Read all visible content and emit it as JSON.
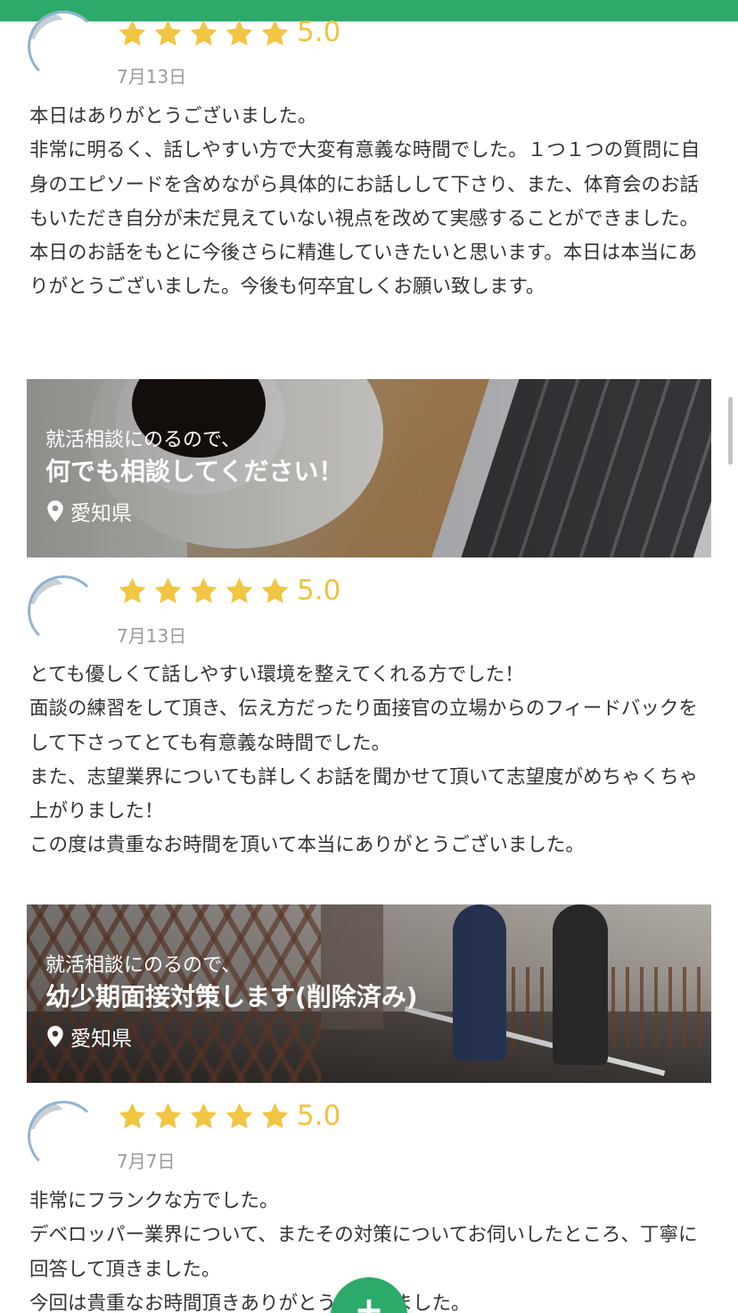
{
  "theme": {
    "accent": "#2baa6a",
    "star": "#f2c542"
  },
  "reviews": [
    {
      "score": "5.0",
      "date": "7月13日",
      "text": "本日はありがとうございました。\n非常に明るく、話しやすい方で大変有意義な時間でした。１つ１つの質問に自身のエピソードを含めながら具体的にお話しして下さり、また、体育会のお話もいただき自分が未だ見えていない視点を改めて実感することができました。\n本日のお話をもとに今後さらに精進していきたいと思います。本日は本当にありがとうございました。今後も何卒宜しくお願い致します。"
    },
    {
      "score": "5.0",
      "date": "7月13日",
      "text": "とても優しくて話しやすい環境を整えてくれる方でした！\n面談の練習をして頂き、伝え方だったり面接官の立場からのフィードバックをして下さってとても有意義な時間でした。\nまた、志望業界についても詳しくお話を聞かせて頂いて志望度がめちゃくちゃ上がりました！\nこの度は貴重なお時間を頂いて本当にありがとうございました。"
    },
    {
      "score": "5.0",
      "date": "7月7日",
      "text": "非常にフランクな方でした。\nデベロッパー業界について、またその対策についてお伺いしたところ、丁寧に回答して頂きました。\n今回は貴重なお時間頂きありがとうございました。"
    }
  ],
  "banners": [
    {
      "subtitle": "就活相談にのるので、",
      "title": "何でも相談してください！",
      "location": "愛知県",
      "icon": "location-pin-icon"
    },
    {
      "subtitle": "就活相談にのるので、",
      "title": "幼少期面接対策します(削除済み)",
      "location": "愛知県",
      "icon": "location-pin-icon"
    }
  ],
  "fab": {
    "label": "+"
  }
}
